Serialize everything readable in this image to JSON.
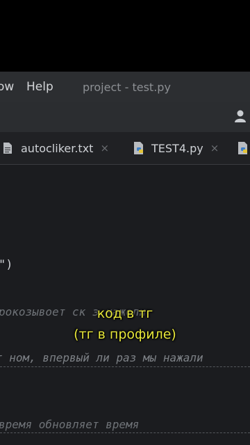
{
  "menu": {
    "window_label": "ow",
    "help_label": "Help",
    "window_title": "project - test.py"
  },
  "tabs": [
    {
      "label": "autocliker.txt",
      "close": "×",
      "icon": "text-file-icon"
    },
    {
      "label": "TEST4.py",
      "close": "×",
      "icon": "python-file-icon"
    },
    {
      "label": "",
      "icon": "python-file-icon"
    }
  ],
  "editor": {
    "lines": [
      {
        "text": "\")"
      },
      {
        "text": "рокозывоет ск           з нажоли"
      },
      {
        "text": "т ном, впервый ли раз мы нажали"
      },
      {
        "text": "время обновляет время"
      }
    ]
  },
  "subtitle": {
    "line1": "код в тг",
    "line2": "(тг в профиле)",
    "color": "#e6e63a"
  },
  "colors": {
    "menubar": "#2c2e31",
    "editor_bg": "#1b1c1f"
  }
}
